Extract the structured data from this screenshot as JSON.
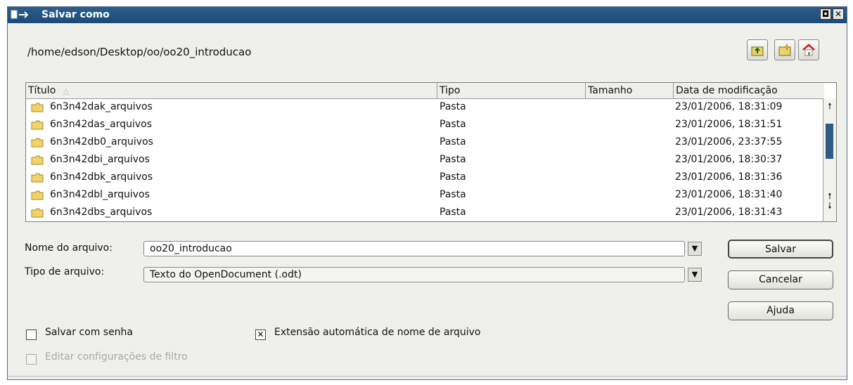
{
  "window": {
    "title": "Salvar como",
    "restore_glyph": "◘",
    "close_glyph": "✕"
  },
  "path": "/home/edson/Desktop/oo/oo20_introducao",
  "toolbar": {
    "icons": [
      "up-one-level-icon",
      "create-new-folder-icon",
      "default-directory-icon"
    ]
  },
  "file_list": {
    "columns": [
      "Título",
      "Tipo",
      "Tamanho",
      "Data de modificação"
    ],
    "sort_indicator": "△",
    "rows": [
      {
        "name": "6n3n42dak_arquivos",
        "type": "Pasta",
        "size": "",
        "modified": "23/01/2006, 18:31:09"
      },
      {
        "name": "6n3n42das_arquivos",
        "type": "Pasta",
        "size": "",
        "modified": "23/01/2006, 18:31:51"
      },
      {
        "name": "6n3n42db0_arquivos",
        "type": "Pasta",
        "size": "",
        "modified": "23/01/2006, 23:37:55"
      },
      {
        "name": "6n3n42dbi_arquivos",
        "type": "Pasta",
        "size": "",
        "modified": "23/01/2006, 18:30:37"
      },
      {
        "name": "6n3n42dbk_arquivos",
        "type": "Pasta",
        "size": "",
        "modified": "23/01/2006, 18:31:36"
      },
      {
        "name": "6n3n42dbl_arquivos",
        "type": "Pasta",
        "size": "",
        "modified": "23/01/2006, 18:31:40"
      },
      {
        "name": "6n3n42dbs_arquivos",
        "type": "Pasta",
        "size": "",
        "modified": "23/01/2006, 18:31:43"
      }
    ],
    "scroll_up_glyph": "🠕",
    "scroll_down_glyph": "🠗"
  },
  "form": {
    "filename_label": "Nome do arquivo:",
    "filename_value": "oo20_introducao",
    "filetype_label": "Tipo de arquivo:",
    "filetype_value": "Texto do OpenDocument (.odt)",
    "dropdown_glyph": "▼"
  },
  "buttons": {
    "save": "Salvar",
    "cancel": "Cancelar",
    "help": "Ajuda"
  },
  "options": {
    "save_with_password": {
      "label": "Salvar com senha",
      "checked": false
    },
    "auto_extension": {
      "label": "Extensão automática de nome de arquivo",
      "checked": true,
      "mark": "✕"
    },
    "edit_filter_settings": {
      "label": "Editar configurações de filtro",
      "checked": false,
      "disabled": true
    }
  },
  "colors": {
    "titlebar": "#1d4b77",
    "dialog_bg": "#efefec",
    "folder": "#f2d36b"
  }
}
